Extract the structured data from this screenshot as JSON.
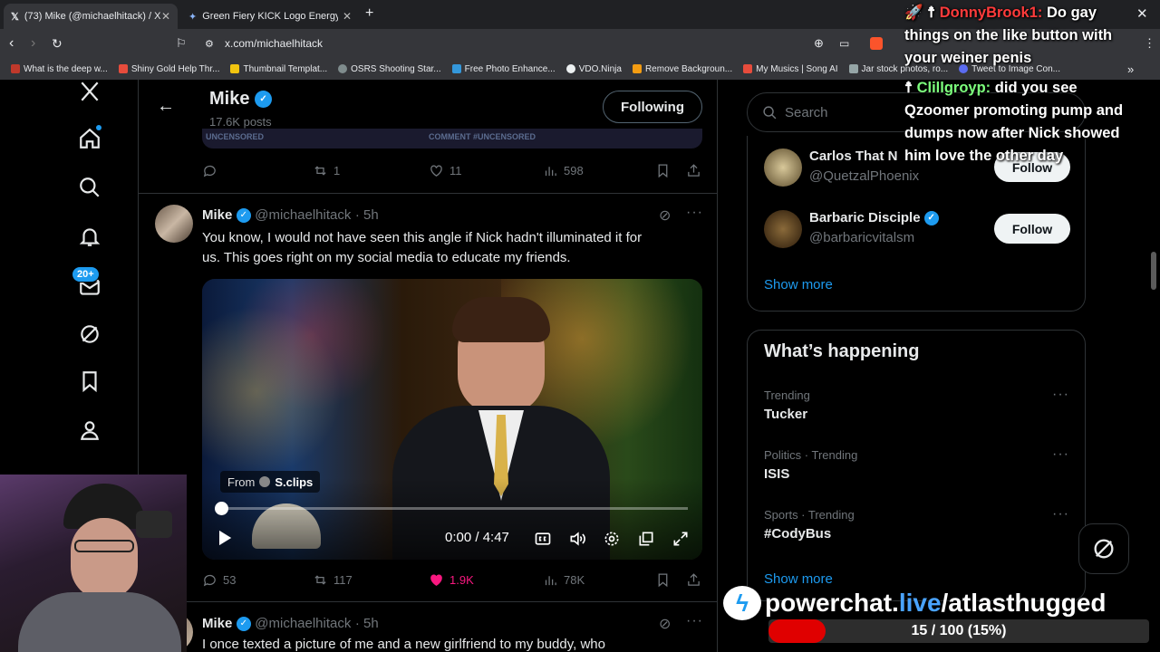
{
  "browser": {
    "tabs": [
      {
        "label": "(73) Mike (@michaelhitack) / X",
        "favicon": "x-icon"
      },
      {
        "label": "Green Fiery KICK Logo Energy - Goog",
        "favicon": "gemini-icon"
      }
    ],
    "new_tab": "+",
    "url": "x.com/michaelhitack",
    "bookmarks": [
      {
        "label": "What is the deep w...",
        "color": "#c0392b"
      },
      {
        "label": "Shiny Gold Help Thr...",
        "color": "#e74c3c"
      },
      {
        "label": "Thumbnail Templat...",
        "color": "#f1c40f"
      },
      {
        "label": "OSRS Shooting Star...",
        "color": "#7f8c8d"
      },
      {
        "label": "Free Photo Enhance...",
        "color": "#3498db"
      },
      {
        "label": "VDO.Ninja",
        "color": "#ecf0f1"
      },
      {
        "label": "Remove Backgroun...",
        "color": "#f39c12"
      },
      {
        "label": "My Musics | Song AI",
        "color": "#e74c3c"
      },
      {
        "label": "Jar stock photos, ro...",
        "color": "#95a5a6"
      },
      {
        "label": "Tweet to Image Con...",
        "color": "#5b6cf0"
      }
    ]
  },
  "sidebar": {
    "notification_badge": "20+"
  },
  "profile_header": {
    "name": "Mike",
    "posts": "17.6K posts",
    "following_label": "Following"
  },
  "prev_tweet": {
    "banner_left": "UNCENSORED",
    "banner_mid": "COMMENT #UNCENSORED",
    "replies": "",
    "retweets": "1",
    "likes": "11",
    "views": "598"
  },
  "tweet": {
    "name": "Mike",
    "handle": "@michaelhitack",
    "time": "· 5h",
    "text_line1": "You know, I would not have seen this angle if Nick hadn't illuminated it for",
    "text_line2": "us. This goes right on my social media to educate my friends.",
    "video": {
      "from_label": "From",
      "source": "S.clips",
      "time": "0:00 / 4:47",
      "progress": 0.0
    },
    "replies": "53",
    "retweets": "117",
    "likes": "1.9K",
    "views": "78K"
  },
  "next_tweet": {
    "name": "Mike",
    "handle": "@michaelhitack",
    "time": "· 5h",
    "text_line1": "I once texted a picture of me and a new girlfriend to my buddy, who"
  },
  "search": {
    "placeholder": "Search"
  },
  "who_to_follow": [
    {
      "name": "Carlos That N",
      "handle": "@QuetzalPhoenix",
      "button": "Follow"
    },
    {
      "name": "Barbaric Disciple",
      "handle": "@barbaricvitalsm",
      "button": "Follow"
    }
  ],
  "show_more": "Show more",
  "whats_happening": {
    "title": "What’s happening",
    "trends": [
      {
        "meta": "Trending",
        "name": "Tucker"
      },
      {
        "meta": "Politics · Trending",
        "name": "ISIS"
      },
      {
        "meta": "Sports · Trending",
        "name": "#CodyBus"
      }
    ],
    "show_more": "Show more"
  },
  "overlay": {
    "chat": [
      {
        "user": "DonnyBrook1:",
        "user_color": "#ff3b3b",
        "msg_line1": "Do gay",
        "msg_line2": "things on the like button with",
        "msg_line3": "your weiner penis"
      },
      {
        "user": "Clillgroyp:",
        "user_color": "#7dff7d",
        "msg_line1": "did you see",
        "msg_line2": "Qzoomer promoting pump and",
        "msg_line3": "dumps now after Nick showed",
        "msg_line4": "him love the other day"
      }
    ],
    "powerchat_url_white": "powerchat.",
    "powerchat_url_blue": "live",
    "powerchat_url_rest": "/atlasthugged",
    "goal_text": "15 / 100 (15%)",
    "goal_progress": 0.15
  },
  "colors": {
    "accent": "#1d9bf0",
    "like": "#f91880",
    "bg": "#000000"
  }
}
